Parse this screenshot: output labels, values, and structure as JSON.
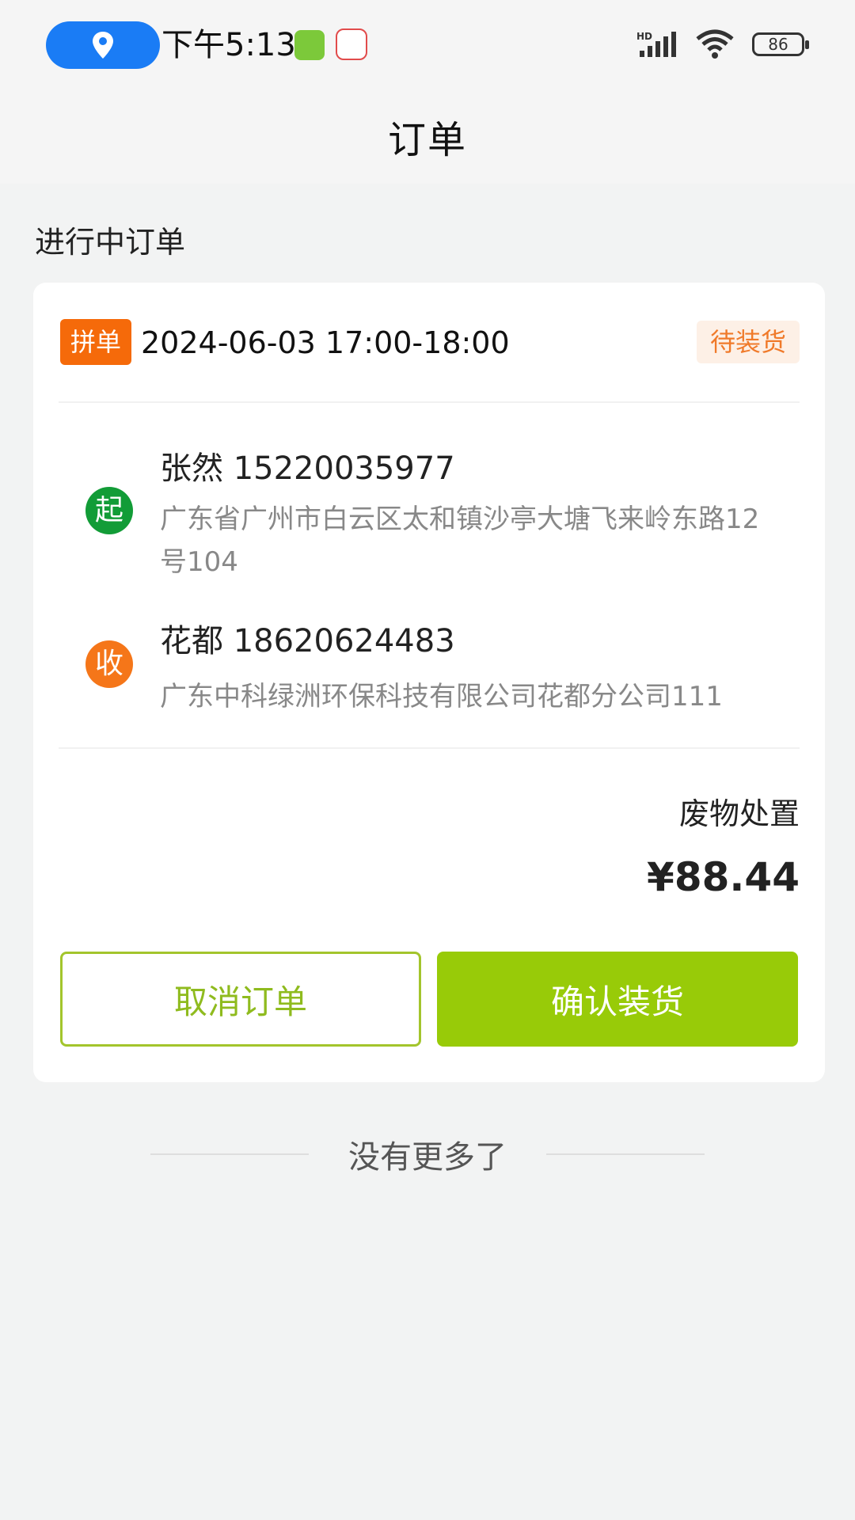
{
  "status_bar": {
    "time": "下午5:13",
    "battery": "86",
    "network": "HD"
  },
  "header": {
    "title": "订单"
  },
  "section": {
    "title": "进行中订单"
  },
  "order": {
    "tag": "拼单",
    "time_slot": "2024-06-03 17:00-18:00",
    "status": "待装货",
    "sender": {
      "mark": "起",
      "name_phone": "张然 15220035977",
      "address": "广东省广州市白云区太和镇沙亭大塘飞来岭东路12号104"
    },
    "receiver": {
      "mark": "收",
      "name_phone": "花都 18620624483",
      "address": "广东中科绿洲环保科技有限公司花都分公司111"
    },
    "service": "废物处置",
    "price": "¥88.44",
    "cancel_label": "取消订单",
    "confirm_label": "确认装货"
  },
  "footer": {
    "no_more": "没有更多了"
  }
}
